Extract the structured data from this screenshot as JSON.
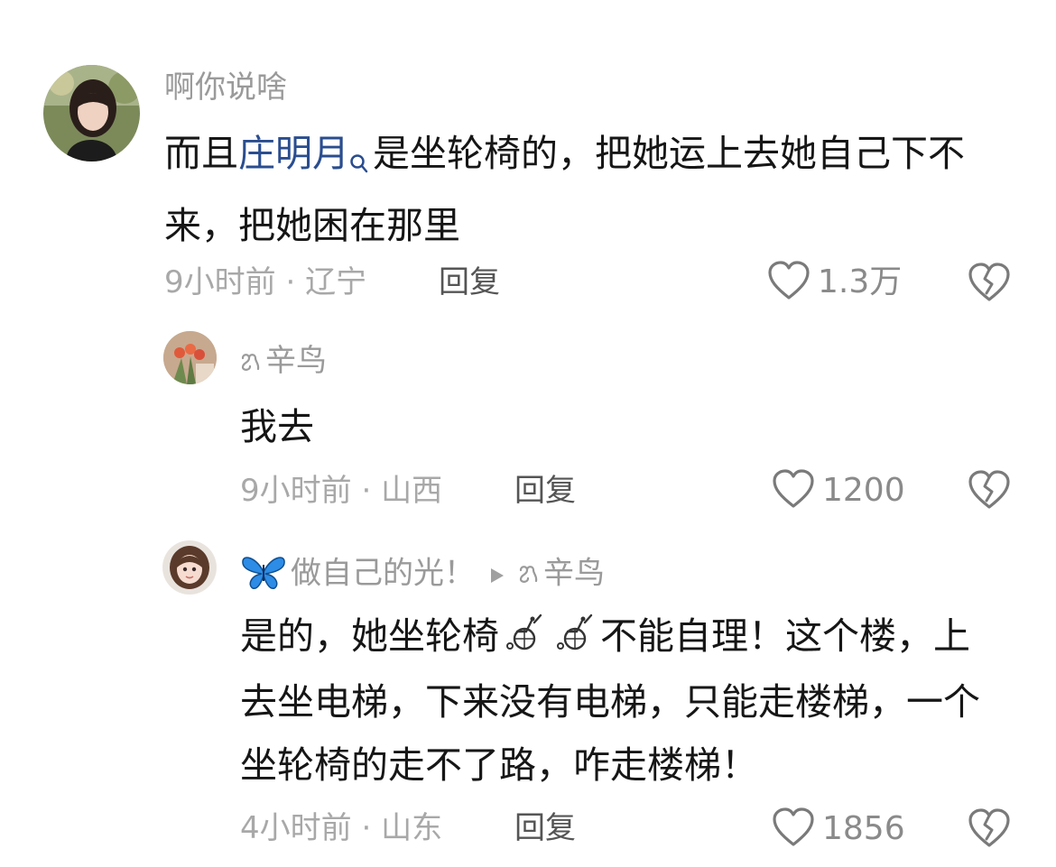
{
  "comments": [
    {
      "username": "啊你说啥",
      "text_before": "而且",
      "topic_link": "庄明月",
      "text_after": "是坐轮椅的，把她运上去她自己下不来，把她困在那里",
      "time": "9小时前",
      "location": "辽宁",
      "reply_label": "回复",
      "likes": "1.3万"
    },
    {
      "username": "辛鸟",
      "username_prefix_icon": "custom-symbol-icon",
      "text": "我去",
      "time": "9小时前",
      "location": "山西",
      "reply_label": "回复",
      "likes": "1200"
    },
    {
      "username": "做自己的光！",
      "username_prefix_icon": "butterfly-icon",
      "reply_to": "辛鸟",
      "reply_to_prefix_icon": "custom-symbol-icon",
      "text_part1": "是的，她坐轮椅",
      "text_part2": "不能自理！这个楼，上去坐电梯，下来没有电梯，只能走楼梯，一个坐轮椅的走不了路，咋走楼梯！",
      "inline_emojis": [
        "wheelchair-icon",
        "wheelchair-icon"
      ],
      "time": "4小时前",
      "location": "山东",
      "reply_label": "回复",
      "likes": "1856"
    }
  ],
  "meta_separator": " · ",
  "colors": {
    "topic_link": "#2a4d8f",
    "butterfly": "#2d8ce6",
    "meta_text": "#a8a8a8"
  }
}
